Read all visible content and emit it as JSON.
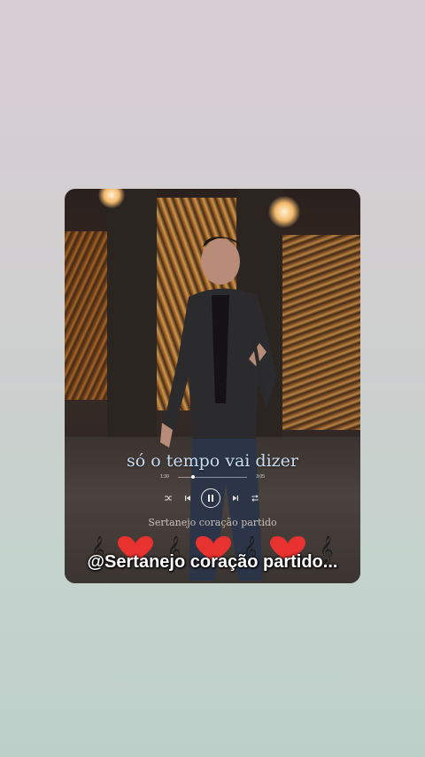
{
  "video": {
    "lyric": "só o tempo vai dizer",
    "player": {
      "elapsed": "1:30",
      "duration": "3:05",
      "progress": 0.22
    },
    "watermark": "Sertanejo coração partido",
    "caption": "@Sertanejo coração partido..."
  },
  "icons": {
    "shuffle": "shuffle-icon",
    "previous": "skip-previous-icon",
    "pause": "pause-icon",
    "next": "skip-next-icon",
    "repeat": "repeat-icon",
    "note": "music-note-icon",
    "heart": "heart-icon"
  },
  "colors": {
    "lyric": "#c9dcf2",
    "heart": "#e8322f",
    "caption": "#ffffff"
  }
}
